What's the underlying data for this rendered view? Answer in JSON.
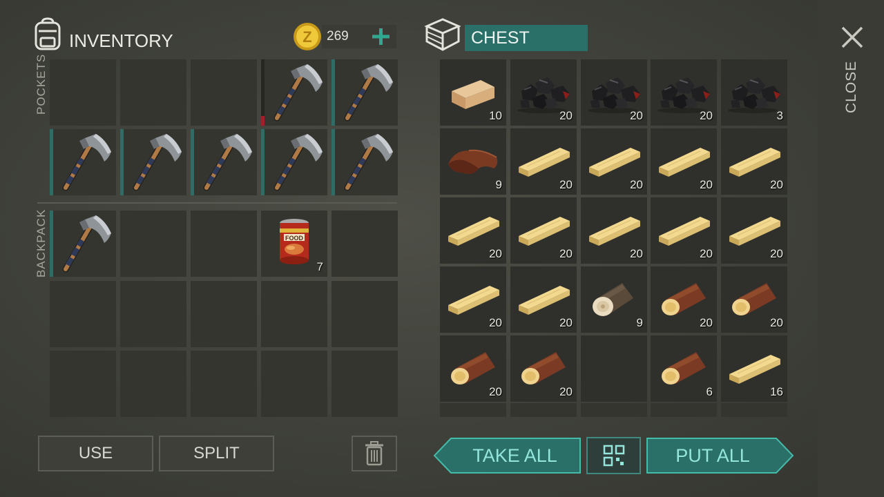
{
  "inventory": {
    "title": "INVENTORY",
    "coins": "269",
    "pockets_label": "POCKETS",
    "backpack_label": "BACKPACK",
    "pockets": [
      {
        "item": "empty",
        "qty": "",
        "dura": "none"
      },
      {
        "item": "empty",
        "qty": "",
        "dura": "none"
      },
      {
        "item": "empty",
        "qty": "",
        "dura": "none"
      },
      {
        "item": "axe-icon",
        "qty": "",
        "dura": "low"
      },
      {
        "item": "axe-icon",
        "qty": "",
        "dura": "full"
      },
      {
        "item": "axe-icon",
        "qty": "",
        "dura": "full"
      },
      {
        "item": "axe-icon",
        "qty": "",
        "dura": "full"
      },
      {
        "item": "axe-icon",
        "qty": "",
        "dura": "full"
      },
      {
        "item": "axe-icon",
        "qty": "",
        "dura": "full"
      },
      {
        "item": "axe-icon",
        "qty": "",
        "dura": "full"
      }
    ],
    "backpack": [
      {
        "item": "axe-icon",
        "qty": "",
        "dura": "full"
      },
      {
        "item": "empty",
        "qty": "",
        "dura": "none"
      },
      {
        "item": "empty",
        "qty": "",
        "dura": "none"
      },
      {
        "item": "canned-food-icon",
        "qty": "7",
        "dura": "none",
        "can_text": "FOOD"
      },
      {
        "item": "empty",
        "qty": "",
        "dura": "none"
      },
      {
        "item": "empty",
        "qty": "",
        "dura": "none"
      },
      {
        "item": "empty",
        "qty": "",
        "dura": "none"
      },
      {
        "item": "empty",
        "qty": "",
        "dura": "none"
      },
      {
        "item": "empty",
        "qty": "",
        "dura": "none"
      },
      {
        "item": "empty",
        "qty": "",
        "dura": "none"
      },
      {
        "item": "empty",
        "qty": "",
        "dura": "none"
      },
      {
        "item": "empty",
        "qty": "",
        "dura": "none"
      },
      {
        "item": "empty",
        "qty": "",
        "dura": "none"
      },
      {
        "item": "empty",
        "qty": "",
        "dura": "none"
      },
      {
        "item": "empty",
        "qty": "",
        "dura": "none"
      }
    ],
    "use_label": "USE",
    "split_label": "SPLIT"
  },
  "chest": {
    "title": "CHEST",
    "slots": [
      {
        "item": "wood-block-icon",
        "qty": "10"
      },
      {
        "item": "coal-icon",
        "qty": "20"
      },
      {
        "item": "coal-icon",
        "qty": "20"
      },
      {
        "item": "coal-icon",
        "qty": "20"
      },
      {
        "item": "coal-icon",
        "qty": "3"
      },
      {
        "item": "leather-icon",
        "qty": "9"
      },
      {
        "item": "plank-icon",
        "qty": "20"
      },
      {
        "item": "plank-icon",
        "qty": "20"
      },
      {
        "item": "plank-icon",
        "qty": "20"
      },
      {
        "item": "plank-icon",
        "qty": "20"
      },
      {
        "item": "plank-icon",
        "qty": "20"
      },
      {
        "item": "plank-icon",
        "qty": "20"
      },
      {
        "item": "plank-icon",
        "qty": "20"
      },
      {
        "item": "plank-icon",
        "qty": "20"
      },
      {
        "item": "plank-icon",
        "qty": "20"
      },
      {
        "item": "plank-icon",
        "qty": "20"
      },
      {
        "item": "plank-icon",
        "qty": "20"
      },
      {
        "item": "birch-log-icon",
        "qty": "9"
      },
      {
        "item": "log-icon",
        "qty": "20"
      },
      {
        "item": "log-icon",
        "qty": "20"
      },
      {
        "item": "log-icon",
        "qty": "20"
      },
      {
        "item": "log-icon",
        "qty": "20"
      },
      {
        "item": "empty",
        "qty": ""
      },
      {
        "item": "log-icon",
        "qty": "6"
      },
      {
        "item": "plank-icon",
        "qty": "16"
      }
    ],
    "take_all_label": "TAKE ALL",
    "put_all_label": "PUT ALL"
  },
  "close_label": "CLOSE",
  "colors": {
    "accent": "#2a6f68",
    "accent_text": "#94e6dc",
    "background": "#45463f"
  }
}
